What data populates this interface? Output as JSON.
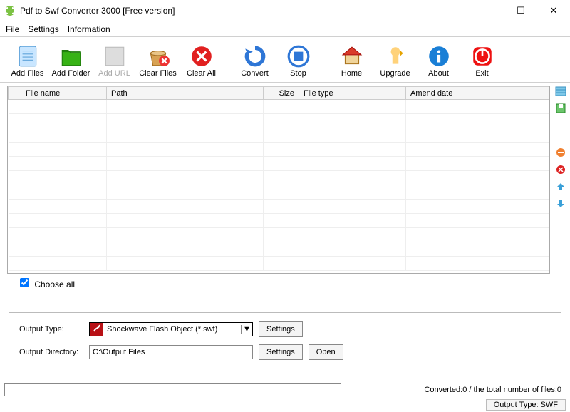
{
  "title": "Pdf to Swf Converter 3000 [Free version]",
  "menu": {
    "file": "File",
    "settings": "Settings",
    "information": "Information"
  },
  "toolbar": {
    "add_files": "Add Files",
    "add_folder": "Add Folder",
    "add_url": "Add URL",
    "clear_files": "Clear Files",
    "clear_all": "Clear All",
    "convert": "Convert",
    "stop": "Stop",
    "home": "Home",
    "upgrade": "Upgrade",
    "about": "About",
    "exit": "Exit"
  },
  "columns": {
    "file_name": "File name",
    "path": "Path",
    "size": "Size",
    "file_type": "File type",
    "amend_date": "Amend date"
  },
  "choose_all": "Choose all",
  "choose_all_checked": true,
  "output": {
    "type_label": "Output Type:",
    "type_value": "Shockwave Flash Object (*.swf)",
    "dir_label": "Output Directory:",
    "dir_value": "C:\\Output Files",
    "settings_btn": "Settings",
    "open_btn": "Open"
  },
  "status": {
    "converted_text": "Converted:0  /  the total number of files:0",
    "output_type_text": "Output Type: SWF"
  }
}
